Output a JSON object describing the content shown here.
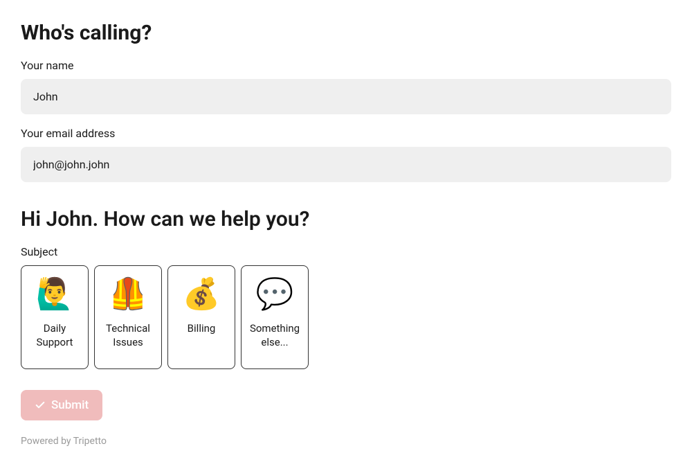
{
  "heading1": "Who's calling?",
  "nameField": {
    "label": "Your name",
    "value": "John"
  },
  "emailField": {
    "label": "Your email address",
    "value": "john@john.john"
  },
  "heading2": "Hi John. How can we help you?",
  "subjectLabel": "Subject",
  "subjects": [
    {
      "icon": "🙋‍♂️",
      "label": "Daily Support"
    },
    {
      "icon": "🦺",
      "label": "Technical Issues"
    },
    {
      "icon": "💰",
      "label": "Billing"
    },
    {
      "icon": "💬",
      "label": "Something else..."
    }
  ],
  "submitLabel": "Submit",
  "footer": "Powered by Tripetto"
}
